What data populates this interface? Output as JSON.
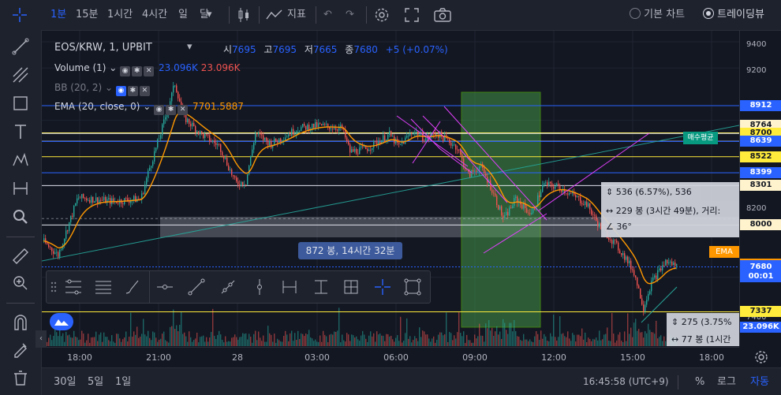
{
  "topbar": {
    "intervals": [
      "1분",
      "15분",
      "1시간",
      "4시간",
      "일",
      "달"
    ],
    "indicator_label": "지표",
    "chart_type_basic": "기본 차트",
    "chart_type_tv": "트레이딩뷰"
  },
  "legend": {
    "symbol": "EOS/KRW, 1, UPBIT",
    "open_label": "시",
    "open_value": "7695",
    "high_label": "고",
    "high_value": "7695",
    "low_label": "저",
    "low_value": "7665",
    "close_label": "종",
    "close_value": "7680",
    "change": "+5 (+0.07%)",
    "volume_title": "Volume (1)",
    "volume_value_1": "23.096K",
    "volume_value_2": "23.096K",
    "bb_title": "BB (20, 2)",
    "ema_title": "EMA (20, close, 0)",
    "ema_value": "7701.5887"
  },
  "price_axis": {
    "ticks": [
      "9400",
      "9200",
      "8200",
      "7400"
    ],
    "labels": [
      {
        "text": "8912",
        "bg": "#2962ff",
        "fg": "#ffffff",
        "price": 8912
      },
      {
        "text": "8764",
        "bg": "#fff3cd",
        "fg": "#131722",
        "price": 8764
      },
      {
        "text": "8704",
        "bg": "#089981",
        "fg": "#ffffff",
        "price": 8704
      },
      {
        "text": "8700",
        "bg": "#ffeb3b",
        "fg": "#131722",
        "price": 8700
      },
      {
        "text": "8640",
        "bg": "#fff3cd",
        "fg": "#131722",
        "price": 8640
      },
      {
        "text": "8639",
        "bg": "#2962ff",
        "fg": "#ffffff",
        "price": 8639
      },
      {
        "text": "8522",
        "bg": "#ffeb3b",
        "fg": "#131722",
        "price": 8522
      },
      {
        "text": "8399",
        "bg": "#2962ff",
        "fg": "#ffffff",
        "price": 8399
      },
      {
        "text": "8301",
        "bg": "#fff3cd",
        "fg": "#131722",
        "price": 8301
      },
      {
        "text": "8000",
        "bg": "#fff3cd",
        "fg": "#131722",
        "price": 8000
      },
      {
        "text": "7702",
        "bg": "#ff9800",
        "fg": "#ffffff",
        "price": 7702
      },
      {
        "text": "7691",
        "bg": "#2962ff",
        "fg": "#ffffff",
        "price": 7691
      },
      {
        "text": "7680",
        "bg": "#2962ff",
        "fg": "#ffffff",
        "price": 7680
      },
      {
        "text": "00:01",
        "bg": "#2962ff",
        "fg": "#ffffff",
        "price": 7602
      },
      {
        "text": "7337",
        "bg": "#ffeb3b",
        "fg": "#131722",
        "price": 7337
      },
      {
        "text": "23.096K",
        "bg": "#2962ff",
        "fg": "#ffffff",
        "price": 7220
      }
    ],
    "ema_tag": "EMA",
    "avg_tag": "매수평균"
  },
  "time_axis": [
    "18:00",
    "21:00",
    "28",
    "03:00",
    "06:00",
    "09:00",
    "12:00",
    "15:00",
    "18:00"
  ],
  "bottombar": {
    "ranges": [
      "30일",
      "5일",
      "1일"
    ],
    "clock": "16:45:58 (UTC+9)",
    "percent": "%",
    "log": "로그",
    "auto": "자동"
  },
  "measure": {
    "range_label": "872 봉, 14시간 32분",
    "box1_line1": "536 (6.57%), 536",
    "box1_line2": "229 봉 (3시간 49분), 거리:",
    "box1_line3": "36°",
    "box2_line1": "275 (3.75%",
    "box2_line2": "77 봉 (1시간"
  },
  "colors": {
    "up": "#26a69a",
    "down": "#ef5350",
    "blue_line": "#2962ff",
    "yellow_line": "#ffeb3b",
    "white_line": "#e0e3eb",
    "ema": "#ff9800"
  }
}
